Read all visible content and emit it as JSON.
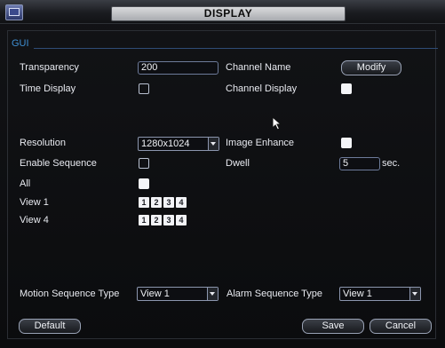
{
  "window": {
    "title": "DISPLAY"
  },
  "gui": {
    "section_label": "GUI",
    "transparency": {
      "label": "Transparency",
      "value": "200"
    },
    "channel_name": {
      "label": "Channel Name",
      "button": "Modify"
    },
    "time_display": {
      "label": "Time Display",
      "checked": false
    },
    "channel_display": {
      "label": "Channel Display",
      "checked": true
    },
    "resolution": {
      "label": "Resolution",
      "value": "1280x1024"
    },
    "image_enhance": {
      "label": "Image Enhance",
      "checked": true
    },
    "enable_sequence": {
      "label": "Enable Sequence",
      "checked": false
    },
    "dwell": {
      "label": "Dwell",
      "value": "5",
      "unit": "sec."
    },
    "all": {
      "label": "All",
      "checked": true
    },
    "view1": {
      "label": "View 1",
      "channels": [
        "1",
        "2",
        "3",
        "4"
      ]
    },
    "view4": {
      "label": "View 4",
      "channels": [
        "1",
        "2",
        "3",
        "4"
      ]
    }
  },
  "sequence": {
    "motion_label": "Motion Sequence Type",
    "motion_value": "View 1",
    "alarm_label": "Alarm Sequence Type",
    "alarm_value": "View 1"
  },
  "buttons": {
    "default": "Default",
    "save": "Save",
    "cancel": "Cancel"
  },
  "icons": {
    "app": "monitor-icon",
    "pointer": "mouse-pointer-icon"
  }
}
